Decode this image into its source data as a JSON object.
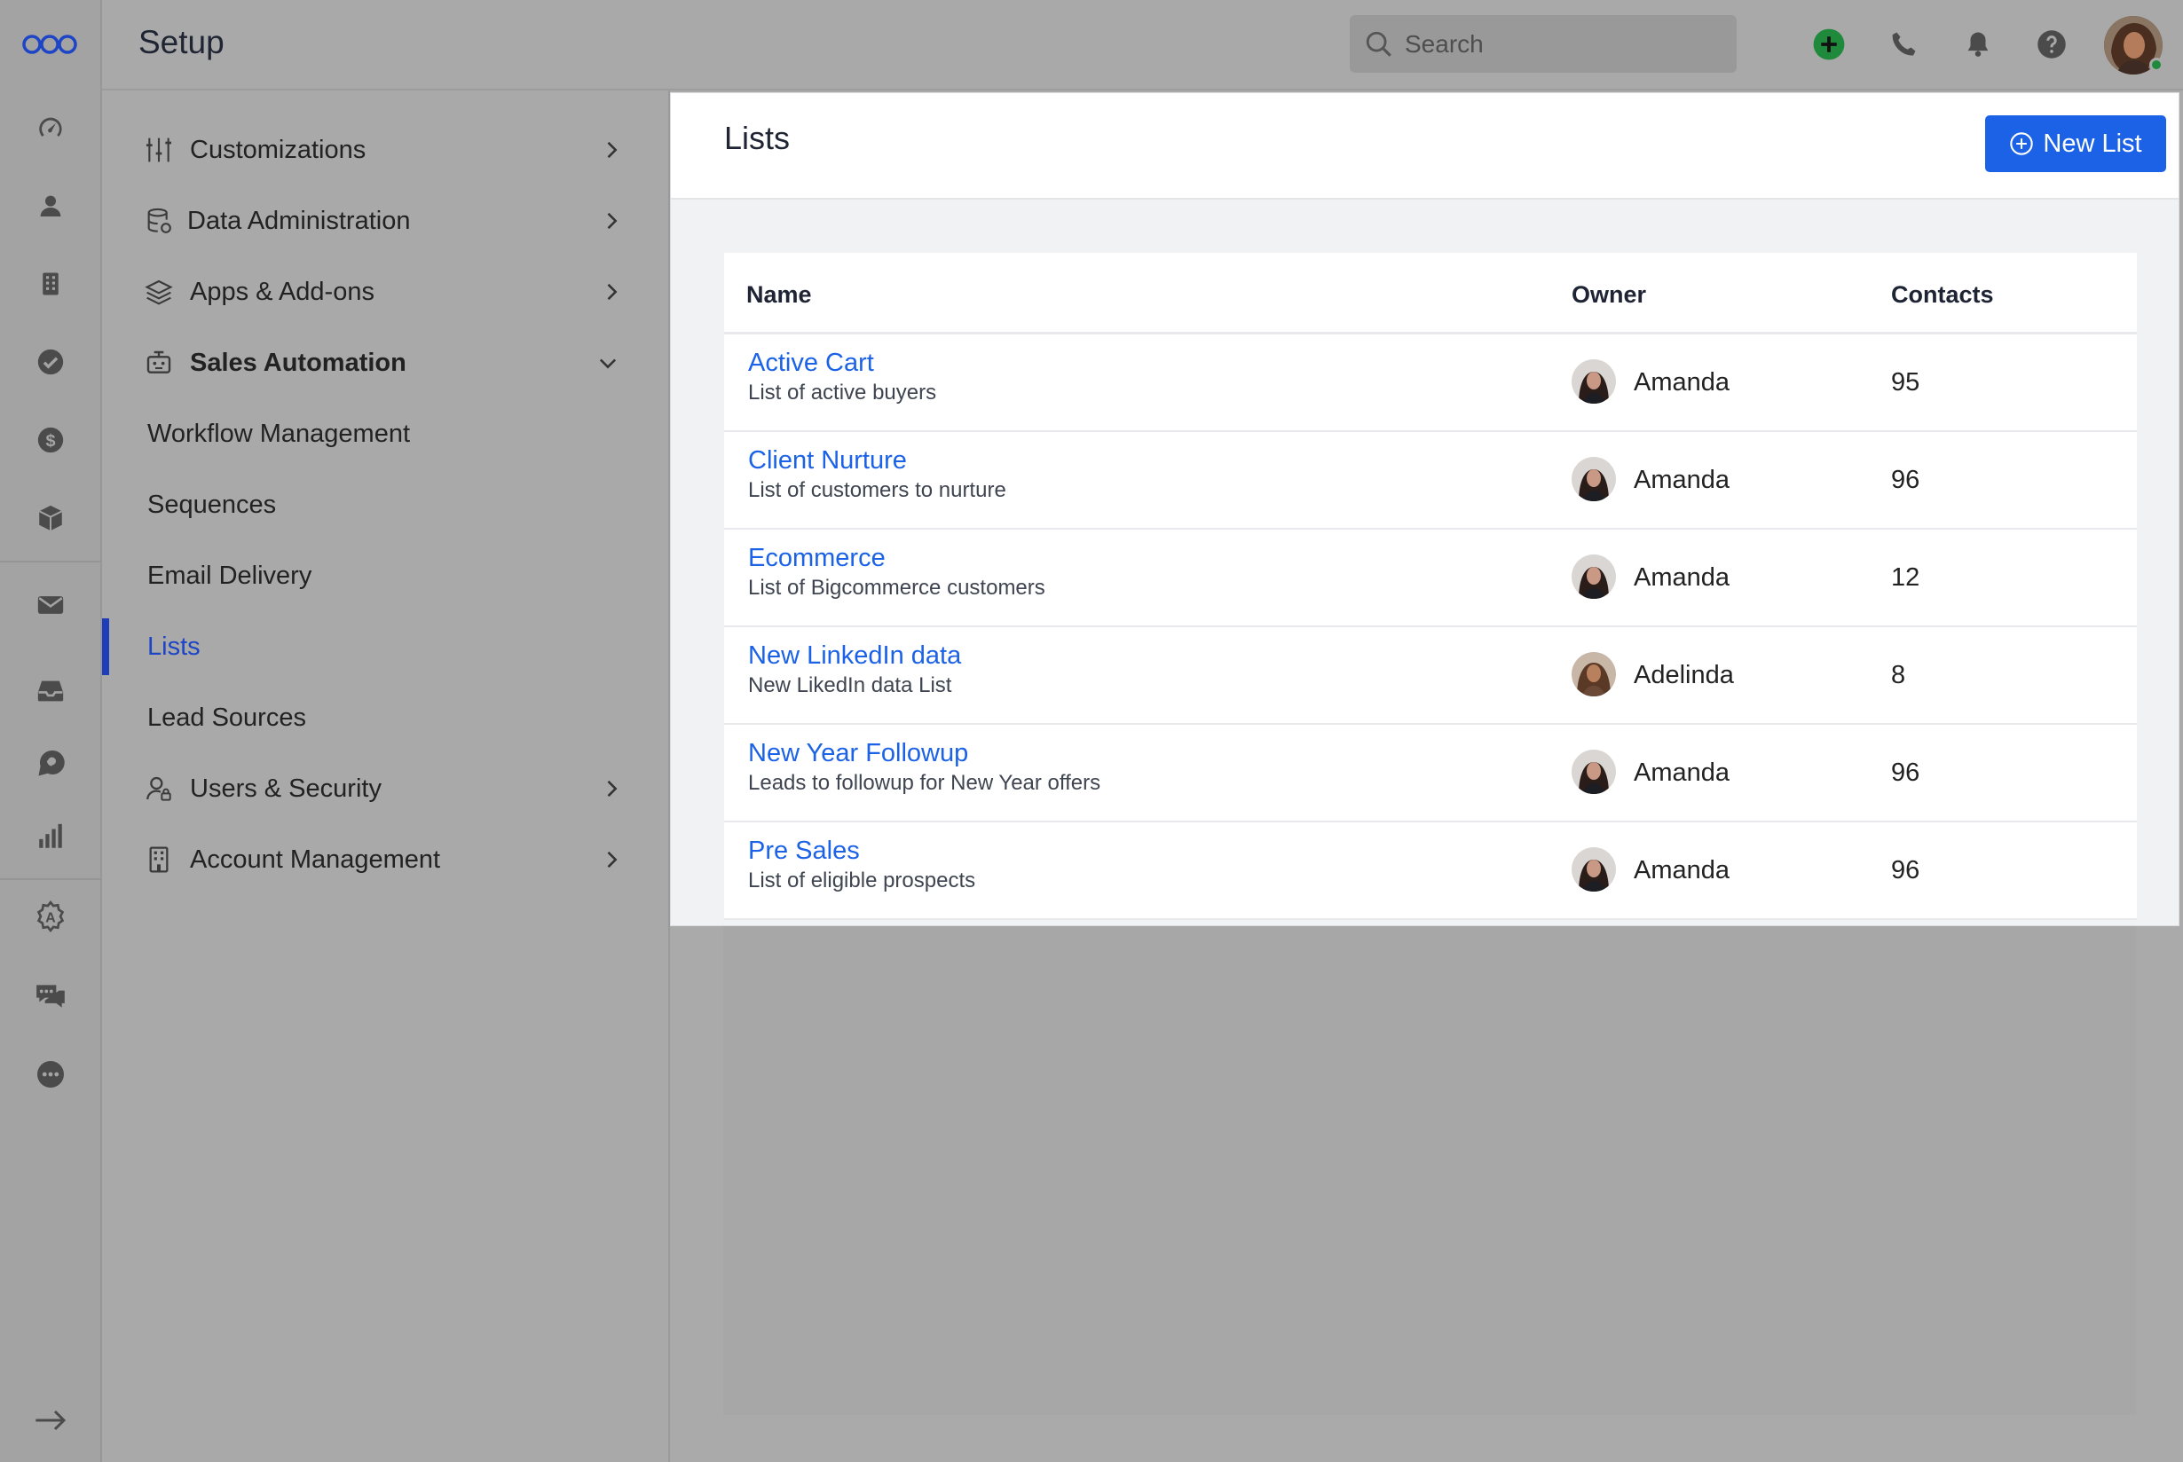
{
  "header": {
    "title": "Setup",
    "search_placeholder": "Search",
    "icons": [
      "add-circle-icon",
      "phone-icon",
      "bell-icon",
      "help-icon"
    ],
    "add_color": "#1f8a3b"
  },
  "rail": {
    "icons": [
      "dashboard-icon",
      "contacts-icon",
      "company-icon",
      "tasks-icon",
      "deals-icon",
      "products-icon",
      "email-icon",
      "inbox-icon",
      "chat-icon",
      "reports-icon",
      "automation-icon",
      "messages-icon",
      "more-icon",
      "expand-icon"
    ]
  },
  "sidebar": {
    "items": [
      {
        "label": "Customizations",
        "icon": "sliders-icon",
        "chevron": "right"
      },
      {
        "label": "Data Administration",
        "icon": "database-icon",
        "chevron": "right"
      },
      {
        "label": "Apps & Add-ons",
        "icon": "layers-icon",
        "chevron": "right"
      },
      {
        "label": "Sales Automation",
        "icon": "robot-icon",
        "chevron": "down"
      },
      {
        "label": "Workflow Management"
      },
      {
        "label": "Sequences"
      },
      {
        "label": "Email Delivery"
      },
      {
        "label": "Lists"
      },
      {
        "label": "Lead Sources"
      },
      {
        "label": "Users & Security",
        "icon": "user-lock-icon",
        "chevron": "right"
      },
      {
        "label": "Account Management",
        "icon": "building-icon",
        "chevron": "right"
      }
    ],
    "active_color": "#1d45c5"
  },
  "main": {
    "title": "Lists",
    "new_button_label": "New List",
    "button_color": "#1b62e6",
    "columns": [
      "Name",
      "Owner",
      "Contacts"
    ],
    "rows": [
      {
        "name": "Active Cart",
        "description": "List of active buyers",
        "owner": "Amanda",
        "contacts": "95"
      },
      {
        "name": "Client Nurture",
        "description": "List of customers to nurture",
        "owner": "Amanda",
        "contacts": "96"
      },
      {
        "name": "Ecommerce",
        "description": "List of Bigcommerce customers",
        "owner": "Amanda",
        "contacts": "12"
      },
      {
        "name": "New LinkedIn data",
        "description": "New LikedIn data List",
        "owner": "Adelinda",
        "contacts": "8"
      },
      {
        "name": "New Year Followup",
        "description": "Leads to followup for New Year offers",
        "owner": "Amanda",
        "contacts": "96"
      },
      {
        "name": "Pre Sales",
        "description": "List of eligible prospects",
        "owner": "Amanda",
        "contacts": "96"
      }
    ]
  }
}
